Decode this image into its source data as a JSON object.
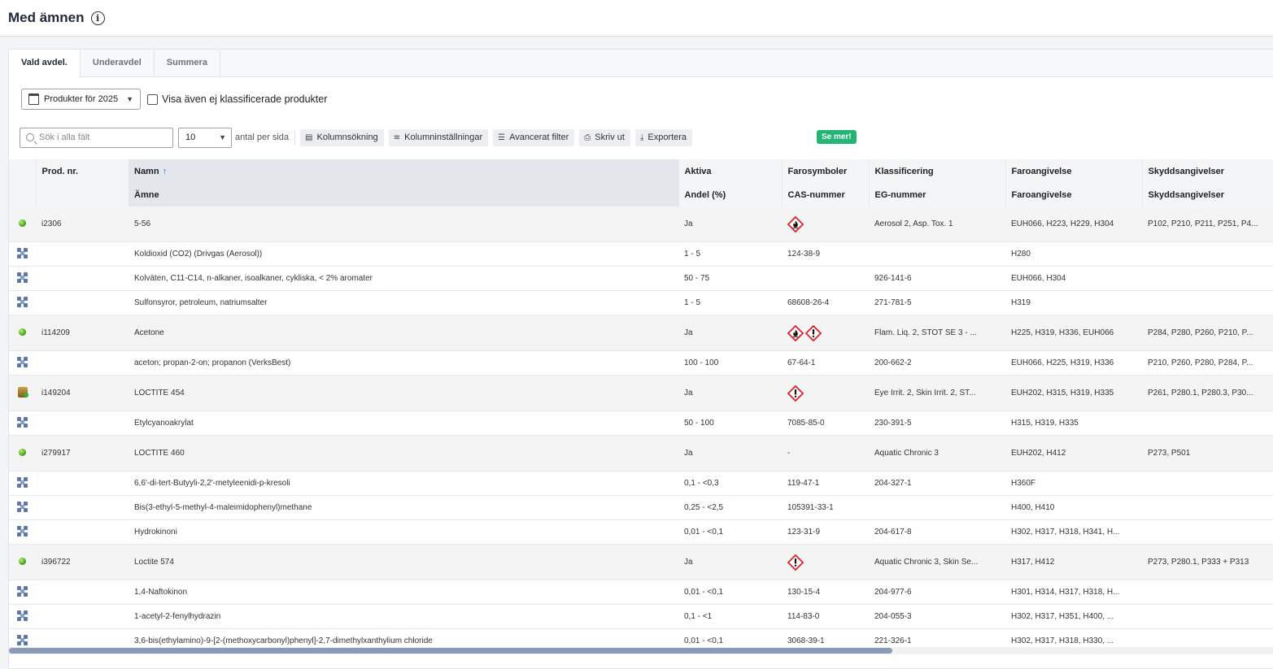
{
  "header": {
    "title": "Med ämnen"
  },
  "tabs": [
    {
      "label": "Vald avdel."
    },
    {
      "label": "Underavdel"
    },
    {
      "label": "Summera"
    }
  ],
  "filters": {
    "year_select": "Produkter för 2025",
    "checkbox_label": "Visa även ej klassificerade produkter"
  },
  "toolbar": {
    "search_placeholder": "Sök i alla fält",
    "page_size": "10",
    "per_page_label": "antal per sida",
    "column_search": "Kolumnsökning",
    "column_settings": "Kolumninställningar",
    "advanced_filter": "Avancerat filter",
    "print": "Skriv ut",
    "export": "Exportera",
    "see_more": "Se mer!"
  },
  "table": {
    "headers_top": [
      "Prod. nr.",
      "Namn",
      "Aktiva",
      "Farosymboler",
      "Klassificering",
      "Faroangivelse",
      "Skyddsangivelser"
    ],
    "headers_bottom": [
      "",
      "Ämne",
      "Andel (%)",
      "CAS-nummer",
      "EG-nummer",
      "Faroangivelse",
      "Skyddsangivelser"
    ],
    "products": [
      {
        "id": "i2306",
        "name": "5-56",
        "active": "Ja",
        "icon": "green-dot-icon",
        "symbols": [
          "flame"
        ],
        "symbols_text": "",
        "classification": "Aerosol 2, Asp. Tox. 1",
        "hazard": "EUH066, H223, H229, H304",
        "precaution": "P102, P210, P211, P251, P4...",
        "substances": [
          {
            "name": "Koldioxid (CO2) (Drivgas (Aerosol))",
            "share": "1 - 5",
            "cas": "124-38-9",
            "eg": "",
            "hazard": "H280"
          },
          {
            "name": "Kolväten, C11-C14, n-alkaner, isoalkaner, cykliska, < 2% aromater",
            "share": "50 - 75",
            "cas": "",
            "eg": "926-141-6",
            "hazard": "EUH066, H304"
          },
          {
            "name": "Sulfonsyror, petroleum, natriumsalter",
            "share": "1 - 5",
            "cas": "68608-26-4",
            "eg": "271-781-5",
            "hazard": "H319"
          }
        ]
      },
      {
        "id": "i114209",
        "name": "Acetone",
        "active": "Ja",
        "icon": "green-dot-icon",
        "symbols": [
          "flame",
          "exclamation"
        ],
        "symbols_text": "",
        "classification": "Flam. Liq. 2, STOT SE 3 - ...",
        "hazard": "H225, H319, H336, EUH066",
        "precaution": "P284, P280, P260, P210, P...",
        "substances": [
          {
            "name": "aceton; propan-2-on; propanon (VerksBest)",
            "share": "100 - 100",
            "cas": "67-64-1",
            "eg": "200-662-2",
            "hazard": "EUH066, H225, H319, H336",
            "precaution": "P210, P260, P280, P284, P..."
          }
        ]
      },
      {
        "id": "i149204",
        "name": "LOCTITE 454",
        "active": "Ja",
        "icon": "package-icon",
        "symbols": [
          "exclamation"
        ],
        "symbols_text": "",
        "classification": "Eye Irrit. 2, Skin Irrit. 2, ST...",
        "hazard": "EUH202, H315, H319, H335",
        "precaution": "P261, P280.1, P280.3, P30...",
        "substances": [
          {
            "name": "Etylcyanoakrylat",
            "share": "50 - 100",
            "cas": "7085-85-0",
            "eg": "230-391-5",
            "hazard": "H315, H319, H335"
          }
        ]
      },
      {
        "id": "i279917",
        "name": "LOCTITE 460",
        "active": "Ja",
        "icon": "green-dot-icon",
        "symbols": [],
        "symbols_text": "-",
        "classification": "Aquatic Chronic 3",
        "hazard": "EUH202, H412",
        "precaution": "P273, P501",
        "substances": [
          {
            "name": "6,6'-di-tert-Butyyli-2,2'-metyleenidi-p-kresoli",
            "share": "0,1 - <0,3",
            "cas": "119-47-1",
            "eg": "204-327-1",
            "hazard": "H360F"
          },
          {
            "name": "Bis(3-ethyl-5-methyl-4-maleimidophenyl)methane",
            "share": "0,25 - <2,5",
            "cas": "105391-33-1",
            "eg": "",
            "hazard": "H400, H410"
          },
          {
            "name": "Hydrokinoni",
            "share": "0,01 - <0,1",
            "cas": "123-31-9",
            "eg": "204-617-8",
            "hazard": "H302, H317, H318, H341, H..."
          }
        ]
      },
      {
        "id": "i396722",
        "name": "Loctite 574",
        "active": "Ja",
        "icon": "green-dot-icon",
        "symbols": [
          "exclamation"
        ],
        "symbols_text": "",
        "classification": "Aquatic Chronic 3, Skin Se...",
        "hazard": "H317, H412",
        "precaution": "P273, P280.1, P333 + P313",
        "substances": [
          {
            "name": "1,4-Naftokinon",
            "share": "0,01 - <0,1",
            "cas": "130-15-4",
            "eg": "204-977-6",
            "hazard": "H301, H314, H317, H318, H..."
          },
          {
            "name": "1-acetyl-2-fenylhydrazin",
            "share": "0,1 - <1",
            "cas": "114-83-0",
            "eg": "204-055-3",
            "hazard": "H302, H317, H351, H400, ..."
          },
          {
            "name": "3,6-bis(ethylamino)-9-[2-(methoxycarbonyl)phenyl]-2,7-dimethylxanthylium chloride",
            "share": "0,01 - <0,1",
            "cas": "3068-39-1",
            "eg": "221-326-1",
            "hazard": "H302, H317, H318, H330, ..."
          }
        ]
      }
    ]
  },
  "colors": {
    "accent": "#2b5d7a",
    "badge": "#22b573",
    "ghs_red": "#e0202a"
  }
}
